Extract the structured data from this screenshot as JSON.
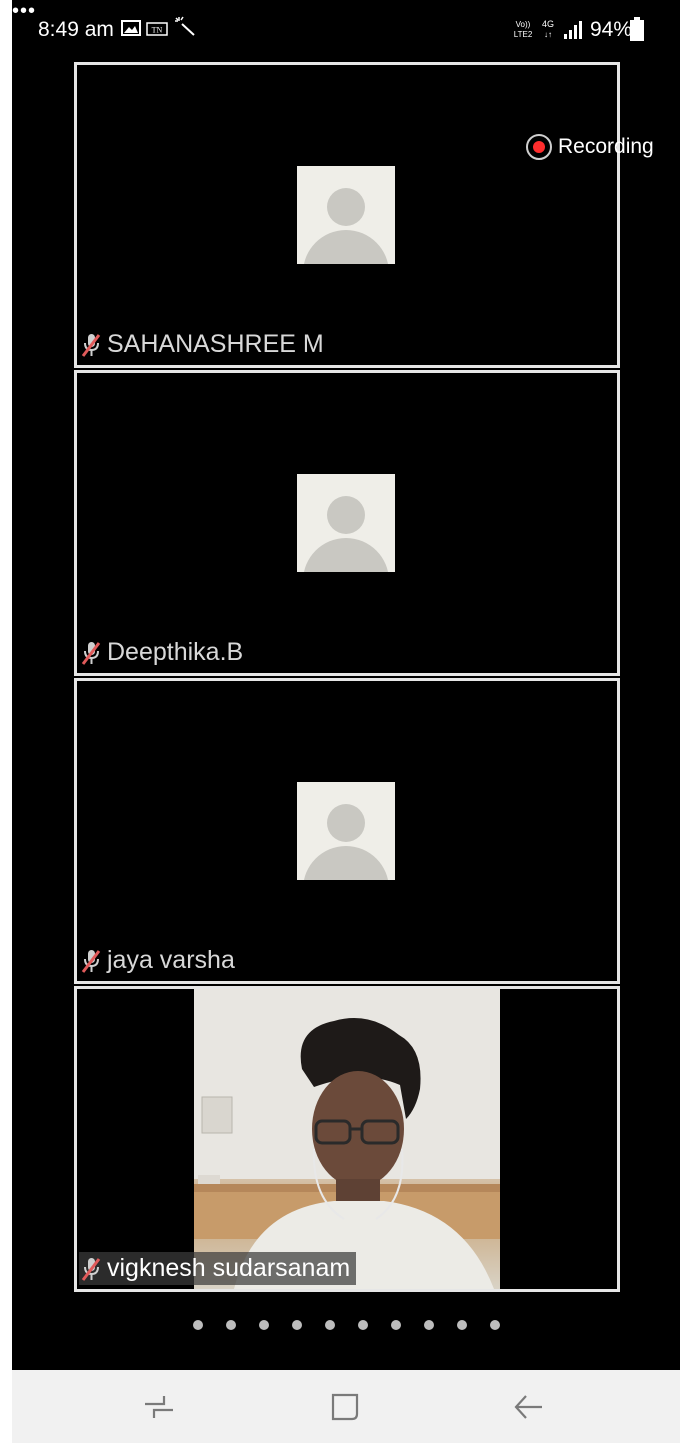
{
  "status_bar": {
    "time": "8:49 am",
    "icons": [
      "gallery-icon",
      "tn-icon",
      "magic-wand-icon",
      "more-dots-icon"
    ],
    "more": "•••",
    "network": "4G",
    "battery_percent": "94%"
  },
  "recording": {
    "label": "Recording",
    "color": "#ff2d2d"
  },
  "participants": [
    {
      "name": "SAHANASHREE M",
      "muted": true,
      "video": false
    },
    {
      "name": "Deepthika.B",
      "muted": true,
      "video": false
    },
    {
      "name": "jaya varsha",
      "muted": true,
      "video": false
    },
    {
      "name": "vigknesh sudarsanam",
      "muted": true,
      "video": true
    }
  ],
  "pagination": {
    "pages": 10
  },
  "nav_bar": {
    "buttons": [
      "recent-apps-icon",
      "home-icon",
      "back-icon"
    ]
  },
  "colors": {
    "tile_border": "#e6e6e6",
    "background": "#000000",
    "avatar_bg": "#efeee8",
    "muted_mic": "#e05a5a"
  }
}
